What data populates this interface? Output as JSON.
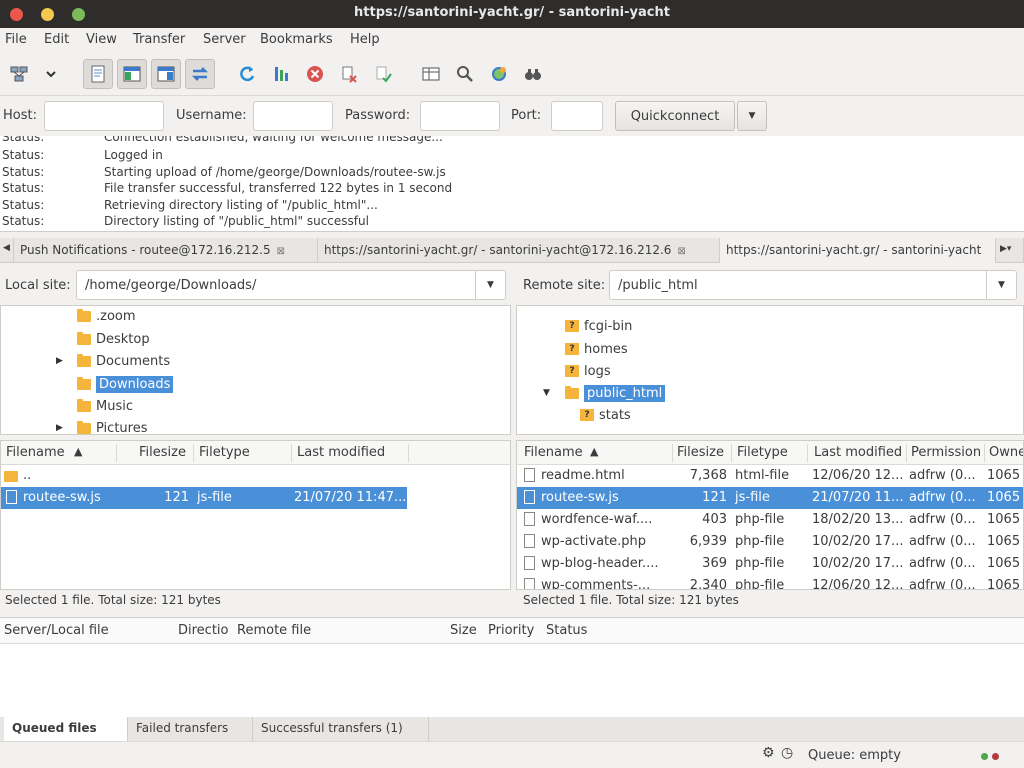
{
  "window": {
    "title": "https://santorini-yacht.gr/ - santorini-yacht"
  },
  "menu": [
    "File",
    "Edit",
    "View",
    "Transfer",
    "Server",
    "Bookmarks",
    "Help"
  ],
  "toolbar_icons": [
    {
      "name": "site-manager-icon"
    },
    {
      "name": "dropdown-icon"
    },
    {
      "name": "toggle-log-icon"
    },
    {
      "name": "toggle-local-tree-icon"
    },
    {
      "name": "toggle-remote-tree-icon"
    },
    {
      "name": "toggle-queue-icon"
    },
    {
      "name": "refresh-icon"
    },
    {
      "name": "process-queue-icon"
    },
    {
      "name": "cancel-icon"
    },
    {
      "name": "disconnect-icon"
    },
    {
      "name": "reconnect-icon"
    },
    {
      "name": "directory-listing-filters-icon"
    },
    {
      "name": "directory-comparison-icon"
    },
    {
      "name": "sync-browsing-icon"
    },
    {
      "name": "find-files-icon"
    }
  ],
  "quickconnect": {
    "host_label": "Host:",
    "username_label": "Username:",
    "password_label": "Password:",
    "port_label": "Port:",
    "button_label": "Quickconnect"
  },
  "log": [
    {
      "key": "Status:",
      "msg": "Connection established, waiting for welcome message..."
    },
    {
      "key": "Status:",
      "msg": "Logged in"
    },
    {
      "key": "Status:",
      "msg": "Starting upload of /home/george/Downloads/routee-sw.js"
    },
    {
      "key": "Status:",
      "msg": "File transfer successful, transferred 122 bytes in 1 second"
    },
    {
      "key": "Status:",
      "msg": "Retrieving directory listing of \"/public_html\"..."
    },
    {
      "key": "Status:",
      "msg": "Directory listing of \"/public_html\" successful"
    }
  ],
  "tabs": [
    {
      "label": "Push Notifications - routee@172.16.212.5"
    },
    {
      "label": "https://santorini-yacht.gr/ - santorini-yacht@172.16.212.6"
    },
    {
      "label": "https://santorini-yacht.gr/ - santorini-yacht"
    }
  ],
  "local": {
    "label": "Local site:",
    "path": "/home/george/Downloads/",
    "tree": [
      ".zoom",
      "Desktop",
      "Documents",
      "Downloads",
      "Music",
      "Pictures"
    ],
    "columns": {
      "filename": "Filename",
      "filesize": "Filesize",
      "filetype": "Filetype",
      "modified": "Last modified"
    },
    "files": [
      {
        "name": "..",
        "size": "",
        "type": "",
        "modified": ""
      },
      {
        "name": "routee-sw.js",
        "size": "121",
        "type": "js-file",
        "modified": "21/07/20 11:47..."
      }
    ],
    "status": "Selected 1 file. Total size: 121 bytes"
  },
  "remote": {
    "label": "Remote site:",
    "path": "/public_html",
    "tree": [
      "fcgi-bin",
      "homes",
      "logs",
      "public_html",
      "stats"
    ],
    "columns": {
      "filename": "Filename",
      "filesize": "Filesize",
      "filetype": "Filetype",
      "modified": "Last modified",
      "permissions": "Permission",
      "owner": "Owne"
    },
    "files": [
      {
        "name": "readme.html",
        "size": "7,368",
        "type": "html-file",
        "modified": "12/06/20 12...",
        "perm": "adfrw (0...",
        "owner": "1065 1"
      },
      {
        "name": "routee-sw.js",
        "size": "121",
        "type": "js-file",
        "modified": "21/07/20 11...",
        "perm": "adfrw (0...",
        "owner": "1065 1"
      },
      {
        "name": "wordfence-waf....",
        "size": "403",
        "type": "php-file",
        "modified": "18/02/20 13...",
        "perm": "adfrw (0...",
        "owner": "1065 1"
      },
      {
        "name": "wp-activate.php",
        "size": "6,939",
        "type": "php-file",
        "modified": "10/02/20 17...",
        "perm": "adfrw (0...",
        "owner": "1065 1"
      },
      {
        "name": "wp-blog-header....",
        "size": "369",
        "type": "php-file",
        "modified": "10/02/20 17...",
        "perm": "adfrw (0...",
        "owner": "1065 1"
      },
      {
        "name": "wp-comments-...",
        "size": "2,340",
        "type": "php-file",
        "modified": "12/06/20 12...",
        "perm": "adfrw (0...",
        "owner": "1065 1"
      }
    ],
    "status": "Selected 1 file. Total size: 121 bytes"
  },
  "queue": {
    "columns": {
      "server": "Server/Local file",
      "direction": "Directio",
      "remote": "Remote file",
      "size": "Size",
      "priority": "Priority",
      "status": "Status"
    },
    "tabs": [
      "Queued files",
      "Failed transfers",
      "Successful transfers (1)"
    ],
    "status": "Queue: empty"
  }
}
